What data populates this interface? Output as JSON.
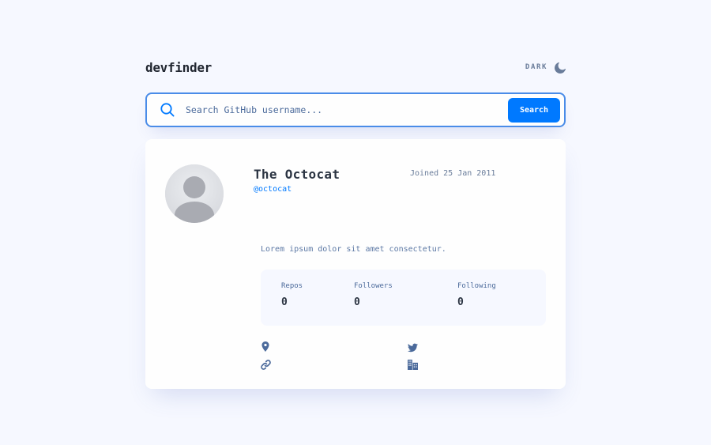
{
  "app": {
    "logo": "devfinder"
  },
  "theme_toggle": {
    "label": "DARK",
    "icon": "moon-icon"
  },
  "search": {
    "placeholder": "Search GitHub username...",
    "value": "",
    "button_label": "Search",
    "icon": "search-icon"
  },
  "profile": {
    "name": "The Octocat",
    "login": "@octocat",
    "joined": "Joined 25 Jan 2011",
    "bio": "Lorem ipsum dolor sit amet consectetur.",
    "avatar_icon": "avatar-placeholder"
  },
  "stats": {
    "repos_label": "Repos",
    "repos_value": "0",
    "followers_label": "Followers",
    "followers_value": "0",
    "following_label": "Following",
    "following_value": "0"
  },
  "links": {
    "location_icon": "location-pin-icon",
    "blog_icon": "link-icon",
    "twitter_icon": "twitter-icon",
    "company_icon": "building-icon"
  },
  "colors": {
    "accent": "#0079ff",
    "background": "#f6f8ff",
    "card": "#fefefe",
    "text_dark": "#2b3442",
    "text_muted": "#4b6a9b"
  }
}
